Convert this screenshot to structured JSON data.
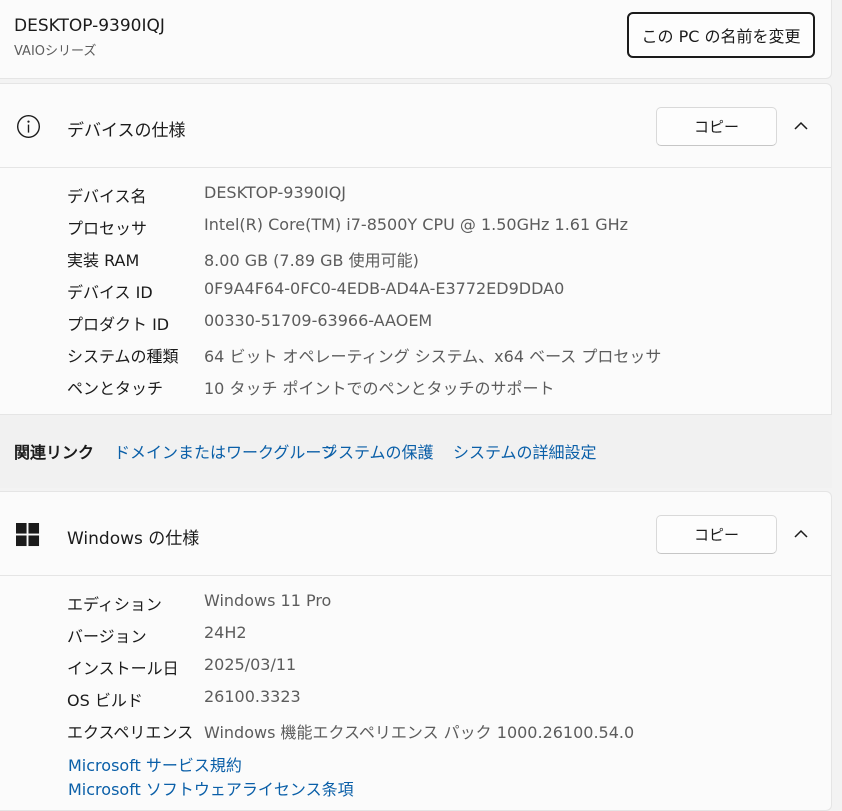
{
  "pc": {
    "name": "DESKTOP-9390IQJ",
    "series": "VAIOシリーズ",
    "rename_label": "この PC の名前を変更"
  },
  "device_specs": {
    "title": "デバイスの仕様",
    "icon": "info-icon",
    "copy_label": "コピー",
    "rows": [
      {
        "key": "デバイス名",
        "value": "DESKTOP-9390IQJ"
      },
      {
        "key": "プロセッサ",
        "value": "Intel(R) Core(TM) i7-8500Y CPU @ 1.50GHz   1.61 GHz"
      },
      {
        "key": "実装 RAM",
        "value": "8.00 GB (7.89 GB 使用可能)"
      },
      {
        "key": "デバイス ID",
        "value": "0F9A4F64-0FC0-4EDB-AD4A-E3772ED9DDA0"
      },
      {
        "key": "プロダクト ID",
        "value": "00330-51709-63966-AAOEM"
      },
      {
        "key": "システムの種類",
        "value": "64 ビット オペレーティング システム、x64 ベース プロセッサ"
      },
      {
        "key": "ペンとタッチ",
        "value": "10 タッチ ポイントでのペンとタッチのサポート"
      }
    ]
  },
  "related_links": {
    "label": "関連リンク",
    "links": [
      "ドメインまたはワークグループ",
      "システムの保護",
      "システムの詳細設定"
    ]
  },
  "windows_specs": {
    "title": "Windows の仕様",
    "icon": "windows-logo-icon",
    "copy_label": "コピー",
    "rows": [
      {
        "key": "エディション",
        "value": "Windows 11 Pro"
      },
      {
        "key": "バージョン",
        "value": "24H2"
      },
      {
        "key": "インストール日",
        "value": "2025/03/11"
      },
      {
        "key": "OS ビルド",
        "value": "26100.3323"
      },
      {
        "key": "エクスペリエンス",
        "value": "Windows 機能エクスペリエンス パック 1000.26100.54.0"
      }
    ],
    "links": [
      "Microsoft サービス規約",
      "Microsoft ソフトウェアライセンス条項"
    ]
  },
  "colors": {
    "accent_link": "#0a5fa8",
    "background": "#f3f3f3",
    "card": "#fbfbfb"
  }
}
